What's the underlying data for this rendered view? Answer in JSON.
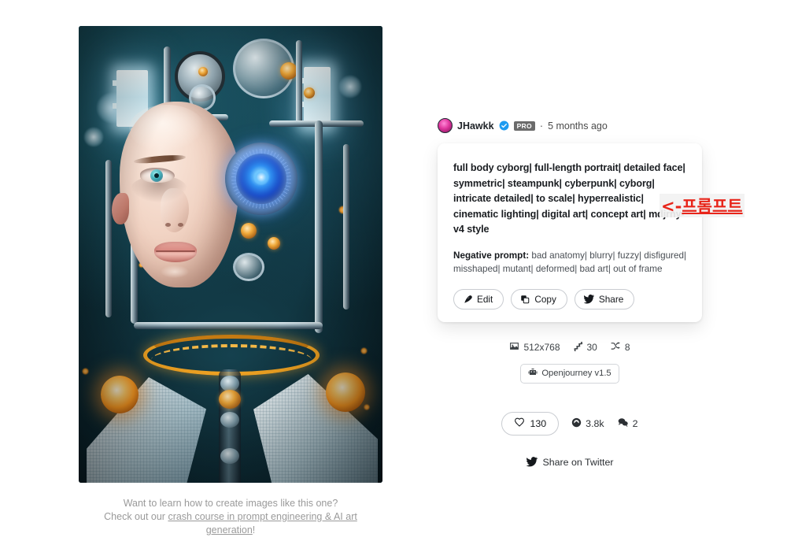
{
  "author": {
    "name": "JHawkk",
    "verified_icon": "verified-check-icon",
    "pro_label": "PRO",
    "separator": "·",
    "time_ago": "5 months ago",
    "avatar_icon": "user-avatar"
  },
  "prompt": {
    "text": "full body cyborg| full-length portrait| detailed face| symmetric| steampunk| cyberpunk| cyborg| intricate detailed| to scale| hyperrealistic| cinematic lighting| digital art| concept art| mdjrny-v4 style",
    "negative_label": "Negative prompt:",
    "negative_text": "bad anatomy| blurry| fuzzy| disfigured| misshaped| mutant| deformed| bad art| out of frame",
    "buttons": [
      {
        "label": "Edit",
        "icon": "pen-icon"
      },
      {
        "label": "Copy",
        "icon": "copy-icon"
      },
      {
        "label": "Share",
        "icon": "twitter-bird-icon"
      }
    ]
  },
  "annotation": {
    "arrow": "<-",
    "korean_text": "프롬프트",
    "color": "#e8251a"
  },
  "meta": {
    "dimensions": "512x768",
    "dimensions_icon": "image-icon",
    "steps": "30",
    "steps_icon": "stairs-steps-icon",
    "cfg_scale": "8",
    "cfg_icon": "shuffle-icon",
    "model_name": "Openjourney v1.5",
    "model_icon": "robot-icon"
  },
  "social": {
    "likes": "130",
    "likes_icon": "heart-icon",
    "views": "3.8k",
    "views_icon": "eye-icon",
    "comments": "2",
    "comments_icon": "comment-bubbles-icon",
    "twitter_share_label": "Share on Twitter",
    "twitter_icon": "twitter-bird-icon"
  },
  "caption": {
    "line1": "Want to learn how to create images like this one?",
    "line2_prefix": "Check out our ",
    "link_text": "crash course in prompt engineering & AI art generation",
    "line2_suffix": "!"
  },
  "artwork": {
    "alt": "AI generated full body cyborg portrait, woman with mechanical implants"
  },
  "colors": {
    "accent_orange": "#f5a623",
    "implant_blue": "#1749c6",
    "annotation_red": "#e8251a",
    "pro_badge_gray": "#6b6b6b",
    "verified_blue": "#1d9bf0"
  }
}
